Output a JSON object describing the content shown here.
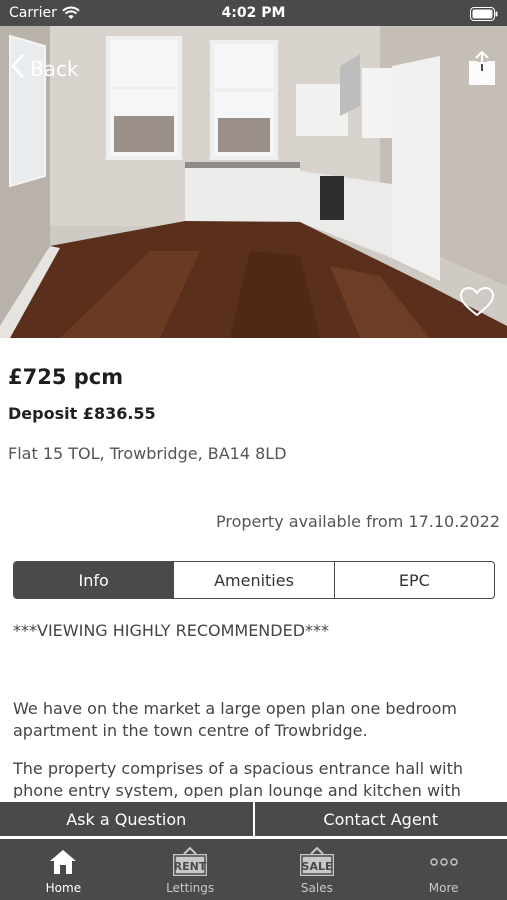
{
  "status_bar": {
    "carrier": "Carrier",
    "time": "4:02 PM"
  },
  "nav": {
    "back_label": "Back"
  },
  "listing": {
    "price": "£725 pcm",
    "deposit": "Deposit £836.55",
    "address": "Flat 15 TOL, Trowbridge, BA14 8LD",
    "available": "Property available from 17.10.2022"
  },
  "tabs": [
    {
      "label": "Info",
      "active": true
    },
    {
      "label": "Amenities",
      "active": false
    },
    {
      "label": "EPC",
      "active": false
    }
  ],
  "description": {
    "headline": "***VIEWING HIGHLY RECOMMENDED***",
    "paragraph1": "We have on the market a large open plan one bedroom apartment in the town centre of Trowbridge.",
    "paragraph2": "The property comprises of a spacious entrance hall with phone entry system, open plan lounge and kitchen with"
  },
  "actions": {
    "ask": "Ask a Question",
    "contact": "Contact Agent"
  },
  "tabbar": [
    {
      "label": "Home",
      "icon": "home-icon",
      "active": true
    },
    {
      "label": "Lettings",
      "icon": "rent-sign-icon",
      "active": false
    },
    {
      "label": "Sales",
      "icon": "sale-sign-icon",
      "active": false
    },
    {
      "label": "More",
      "icon": "more-icon",
      "active": false
    }
  ],
  "icons": {
    "rent_sign_text": "RENT",
    "sale_sign_text": "SALE"
  },
  "colors": {
    "bar": "#4a4a4a",
    "active_tab": "#4a4a4a",
    "text_dark": "#1f1f1f",
    "text_muted": "#555555"
  }
}
